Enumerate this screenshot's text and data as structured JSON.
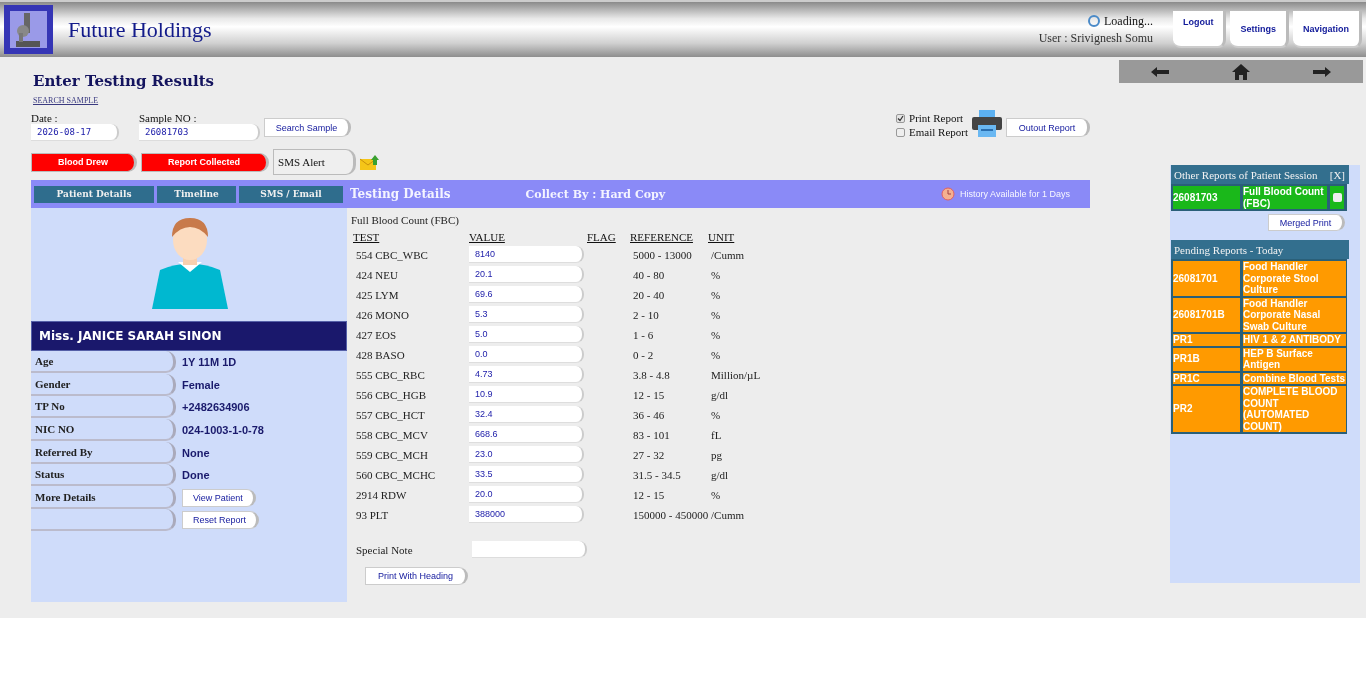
{
  "header": {
    "title": "Future Holdings",
    "loading": "Loading...",
    "user": "User : Srivignesh Somu",
    "buttons": [
      "Logout",
      "Settings",
      "Navigation"
    ]
  },
  "page": {
    "title": "Enter Testing Results",
    "search_link": "SEARCH SAMPLE",
    "date": {
      "label": "Date :",
      "value": "2026-08-17"
    },
    "sample": {
      "label": "Sample NO :",
      "value": "26081703"
    },
    "search_button": "Search Sample",
    "status_buttons": [
      {
        "label": "Blood Drew",
        "kind": "alert"
      },
      {
        "label": "Report Collected",
        "kind": "alert"
      },
      {
        "label": "SMS Alert",
        "kind": "plain"
      }
    ],
    "report_options": [
      {
        "label": "Print Report",
        "checked": true
      },
      {
        "label": "Email Report",
        "checked": false
      }
    ],
    "output_button": "Outout Report"
  },
  "tabs": [
    {
      "label": "Patient Details",
      "selected": false
    },
    {
      "label": "Timeline",
      "selected": false
    },
    {
      "label": "SMS / Email",
      "selected": false
    },
    {
      "label": "Testing Details",
      "selected": true
    }
  ],
  "collect_by": "Collect By : Hard Copy",
  "history": "History Available for 1 Days",
  "patient": {
    "name": "Miss. JANICE SARAH SINON",
    "fields": [
      {
        "label": "Age",
        "value": "1Y 11M 1D"
      },
      {
        "label": "Gender",
        "value": "Female"
      },
      {
        "label": "TP No",
        "value": "+2482634906"
      },
      {
        "label": "NIC NO",
        "value": "024-1003-1-0-78"
      },
      {
        "label": "Referred By",
        "value": "None"
      },
      {
        "label": "Status",
        "value": "Done"
      },
      {
        "label": "More Details",
        "button": "View Patient"
      },
      {
        "button": "Reset Report"
      }
    ]
  },
  "testing": {
    "test_name": "Full Blood Count (FBC)",
    "columns": [
      "TEST",
      "VALUE",
      "FLAG",
      "REFERENCE",
      "UNIT"
    ],
    "rows": [
      {
        "test": "554 CBC_WBC",
        "value": "8140",
        "reference": "5000 - 13000",
        "unit": "/Cumm"
      },
      {
        "test": "424 NEU",
        "value": "20.1",
        "reference": "40 - 80",
        "unit": "%"
      },
      {
        "test": "425 LYM",
        "value": "69.6",
        "reference": "20 - 40",
        "unit": "%"
      },
      {
        "test": "426 MONO",
        "value": "5.3",
        "reference": "2 - 10",
        "unit": "%"
      },
      {
        "test": "427 EOS",
        "value": "5.0",
        "reference": "1 - 6",
        "unit": "%"
      },
      {
        "test": "428 BASO",
        "value": "0.0",
        "reference": "0 - 2",
        "unit": "%"
      },
      {
        "test": "555 CBC_RBC",
        "value": "4.73",
        "reference": "3.8 - 4.8",
        "unit": "Million/µL"
      },
      {
        "test": "556 CBC_HGB",
        "value": "10.9",
        "reference": "12 - 15",
        "unit": "g/dl"
      },
      {
        "test": "557 CBC_HCT",
        "value": "32.4",
        "reference": "36 - 46",
        "unit": "%"
      },
      {
        "test": "558 CBC_MCV",
        "value": "668.6",
        "reference": "83 - 101",
        "unit": "fL"
      },
      {
        "test": "559 CBC_MCH",
        "value": "23.0",
        "reference": "27 - 32",
        "unit": "pg"
      },
      {
        "test": "560 CBC_MCHC",
        "value": "33.5",
        "reference": "31.5 - 34.5",
        "unit": "g/dl"
      },
      {
        "test": "2914 RDW",
        "value": "20.0",
        "reference": "12 - 15",
        "unit": "%"
      },
      {
        "test": "93 PLT",
        "value": "388000",
        "reference": "150000 - 450000",
        "unit": "/Cumm"
      }
    ],
    "special_note": "Special Note",
    "print_button": "Print With Heading"
  },
  "other_reports": {
    "title": "Other Reports of Patient Session",
    "close": "[X]",
    "rows": [
      {
        "id": "26081703",
        "name": "Full Blood Count (FBC)",
        "checked": false
      }
    ],
    "merged_button": "Merged Print"
  },
  "pending": {
    "title": "Pending Reports - Today",
    "rows": [
      {
        "id": "26081701",
        "name": "Food Handler Corporate Stool Culture"
      },
      {
        "id": "26081701B",
        "name": "Food Handler Corporate Nasal Swab Culture"
      },
      {
        "id": "PR1",
        "name": "HIV 1 & 2 ANTIBODY"
      },
      {
        "id": "PR1B",
        "name": "HEP B Surface Antigen"
      },
      {
        "id": "PR1C",
        "name": "Combine Blood Tests"
      },
      {
        "id": "PR2",
        "name": "COMPLETE BLOOD COUNT (AUTOMATED COUNT)"
      }
    ]
  }
}
